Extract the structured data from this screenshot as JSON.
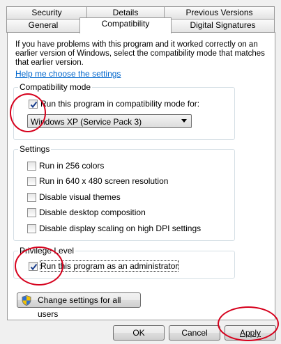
{
  "tabs_row1": [
    {
      "label": "Security"
    },
    {
      "label": "Details"
    },
    {
      "label": "Previous Versions"
    }
  ],
  "tabs_row2": [
    {
      "label": "General"
    },
    {
      "label": "Compatibility"
    },
    {
      "label": "Digital Signatures"
    }
  ],
  "intro": "If you have problems with this program and it worked correctly on an earlier version of Windows, select the compatibility mode that matches that earlier version.",
  "help_link": "Help me choose the settings",
  "compat_group": {
    "title": "Compatibility mode",
    "checkbox_label": "Run this program in compatibility mode for:",
    "checked": true,
    "selected_mode": "Windows XP (Service Pack 3)"
  },
  "settings_group": {
    "title": "Settings",
    "items": [
      {
        "label": "Run in 256 colors",
        "checked": false
      },
      {
        "label": "Run in 640 x 480 screen resolution",
        "checked": false
      },
      {
        "label": "Disable visual themes",
        "checked": false
      },
      {
        "label": "Disable desktop composition",
        "checked": false
      },
      {
        "label": "Disable display scaling on high DPI settings",
        "checked": false
      }
    ]
  },
  "privilege_group": {
    "title": "Privilege Level",
    "checkbox_label": "Run this program as an administrator",
    "checked": true
  },
  "change_all_users_label": "Change settings for all users",
  "buttons": {
    "ok": "OK",
    "cancel": "Cancel",
    "apply": "Apply"
  },
  "colors": {
    "annotation": "#d6001c",
    "link": "#0066cc",
    "check": "#1a3e8c"
  },
  "icons": {
    "uac_shield": "uac-shield-icon"
  }
}
